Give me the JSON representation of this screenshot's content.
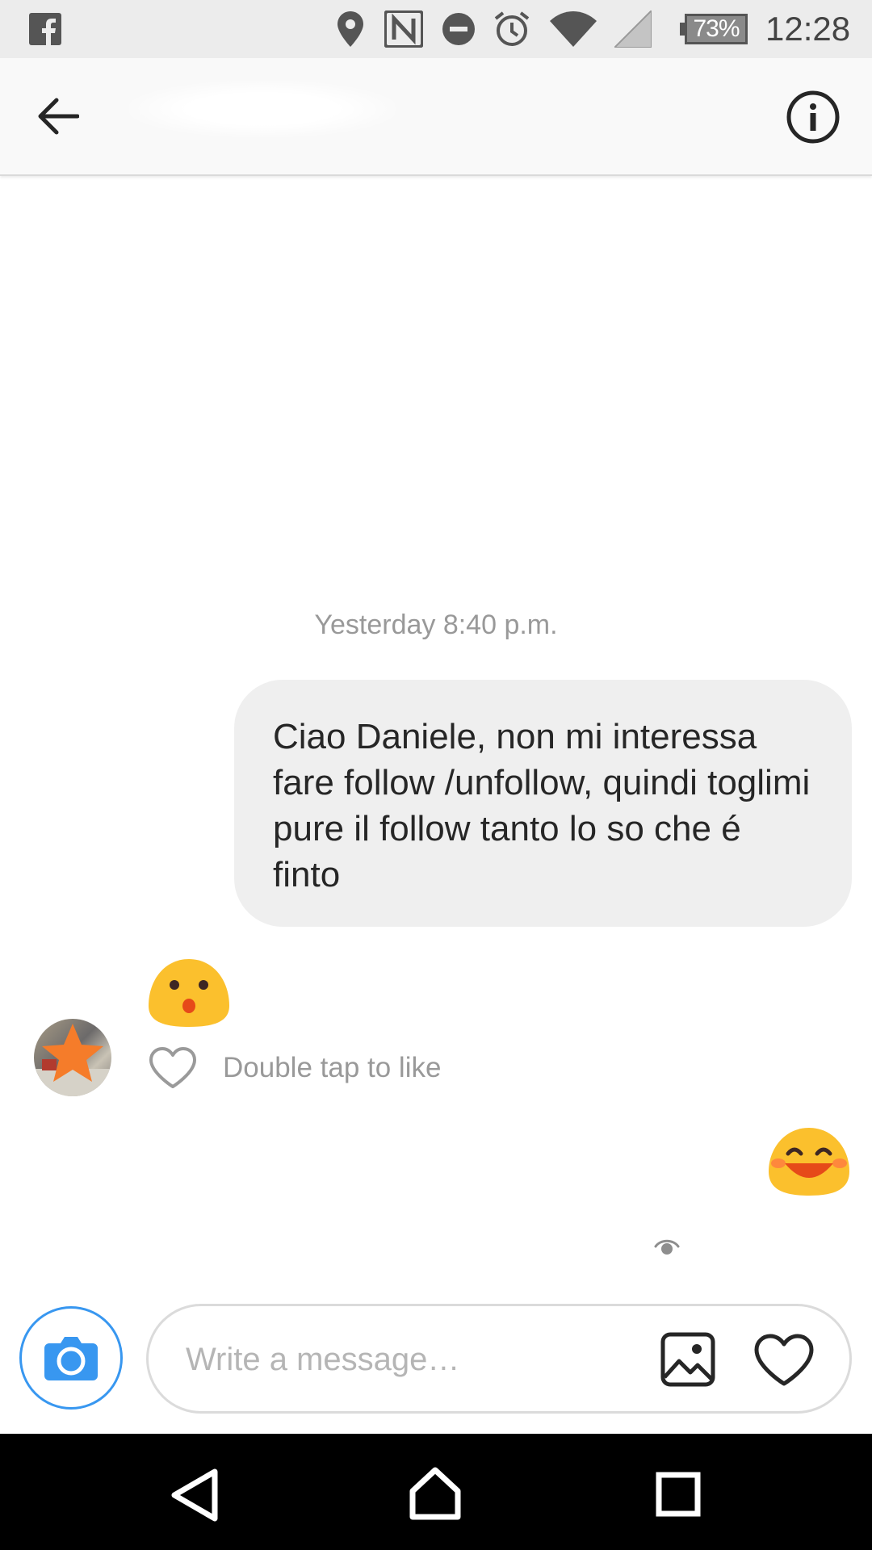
{
  "status_bar": {
    "icons": [
      "facebook-notification-icon",
      "location-icon",
      "nfc-icon",
      "do-not-disturb-icon",
      "alarm-icon",
      "wifi-icon",
      "cell-signal-icon"
    ],
    "battery": "73%",
    "time": "12:28"
  },
  "header": {
    "back_icon": "arrow-left-icon",
    "info_icon": "info-icon"
  },
  "conversation": {
    "timestamp": "Yesterday 8:40 p.m.",
    "messages": [
      {
        "sender": "me",
        "text": "Ciao Daniele, non mi interessa fare follow /unfollow, quindi toglimi pure il follow tanto lo so che é finto"
      },
      {
        "sender": "them",
        "emoji": "hushed-face-emoji"
      },
      {
        "sender": "me",
        "emoji": "smiling-face-emoji"
      }
    ],
    "like_hint": "Double tap to like"
  },
  "composer": {
    "placeholder": "Write a message…",
    "icons": [
      "camera-icon",
      "gallery-icon",
      "heart-icon"
    ]
  },
  "colors": {
    "accent": "#3897f0",
    "bubble": "#efefef",
    "emoji_yellow": "#fbc02d",
    "statusbar_bg": "#ececec",
    "navbar_bg": "#000000"
  }
}
